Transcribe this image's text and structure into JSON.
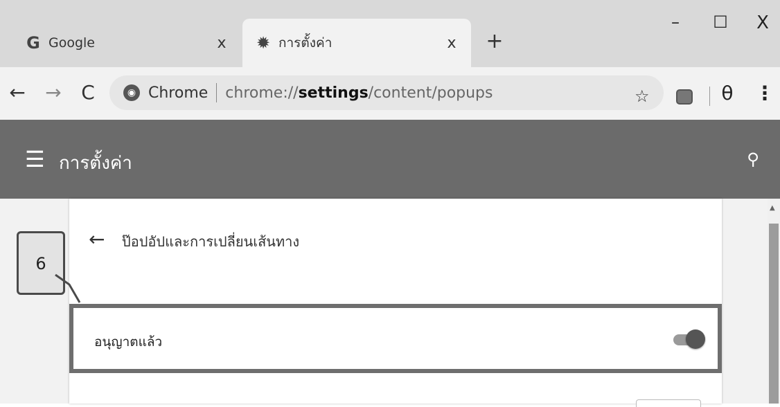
{
  "tabs": [
    {
      "title": "Google",
      "icon": "G",
      "close": "x"
    },
    {
      "title": "การตั้งค่า",
      "icon": "✹",
      "close": "x"
    }
  ],
  "new_tab": "+",
  "window": {
    "minimize": "–",
    "maximize": "☐",
    "close": "X"
  },
  "toolbar": {
    "back": "←",
    "forward": "→",
    "reload": "C",
    "site_label": "Chrome",
    "url_prefix": "chrome://",
    "url_bold": "settings",
    "url_rest": "/content/popups",
    "star": "☆",
    "profile": "θ",
    "menu": "⋮"
  },
  "header": {
    "menu": "☰",
    "title": "การตั้งค่า",
    "search": "⚲"
  },
  "page": {
    "back": "←",
    "title": "ป๊อปอัปและการเปลี่ยนเส้นทาง",
    "allow_label": "อนุญาตแล้ว",
    "toggle_on": true
  },
  "callout": {
    "number": "6"
  },
  "colors": {
    "header_bg": "#6b6b6b",
    "tabstrip_bg": "#d9d9d9",
    "highlight_border": "#6e6e6e"
  }
}
